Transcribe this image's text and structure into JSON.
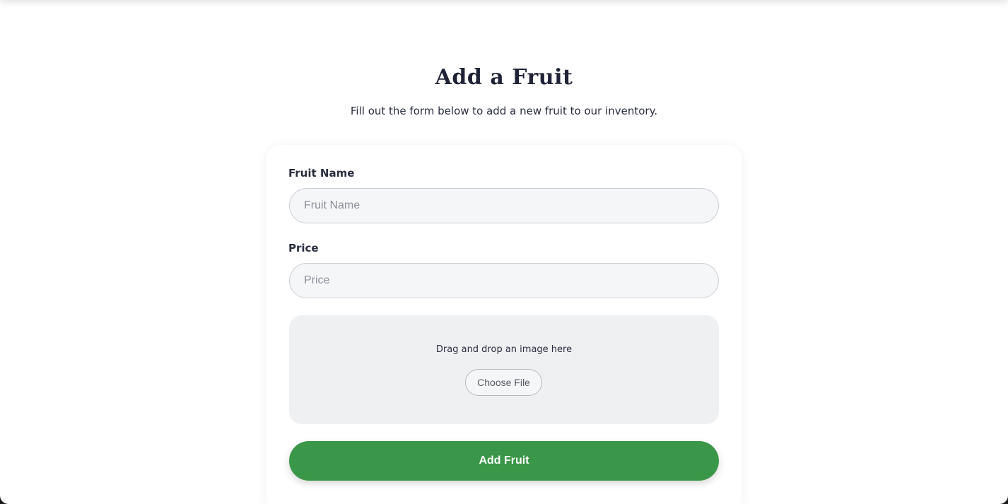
{
  "header": {
    "title": "Add a Fruit",
    "subtitle": "Fill out the form below to add a new fruit to our inventory."
  },
  "form": {
    "fruit_name": {
      "label": "Fruit Name",
      "placeholder": "Fruit Name",
      "value": ""
    },
    "price": {
      "label": "Price",
      "placeholder": "Price",
      "value": ""
    },
    "image_upload": {
      "prompt": "Drag and drop an image here",
      "button_label": "Choose File"
    },
    "submit_label": "Add Fruit"
  },
  "colors": {
    "accent": "#3a9648",
    "heading": "#1f2335",
    "input_background": "#f5f6f8",
    "dropzone_background": "#eff0f2"
  }
}
